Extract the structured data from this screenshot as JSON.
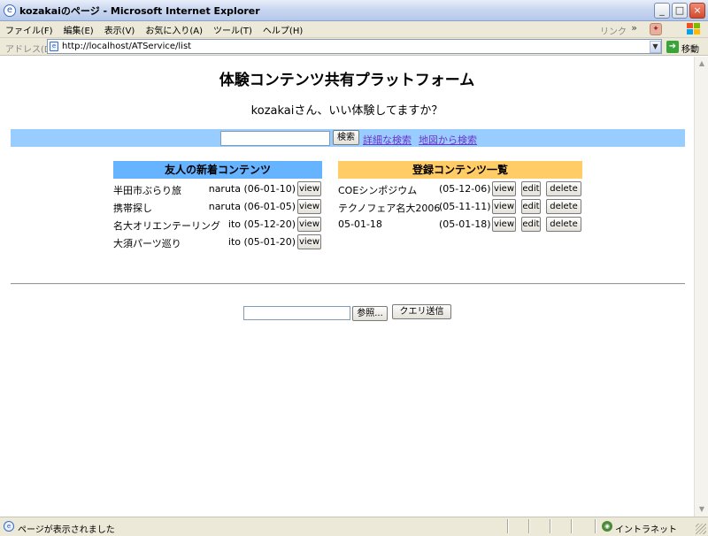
{
  "window": {
    "title": "kozakaiのページ - Microsoft Internet Explorer",
    "min": "_",
    "max": "□",
    "close": "×"
  },
  "menubar": {
    "items": [
      "ファイル(F)",
      "編集(E)",
      "表示(V)",
      "お気に入り(A)",
      "ツール(T)",
      "ヘルプ(H)"
    ],
    "links_label": "リンク",
    "chevron": "»"
  },
  "addressbar": {
    "label": "アドレス(D)",
    "url": "http://localhost/ATService/list",
    "go_label": "移動"
  },
  "page": {
    "title": "体験コンテンツ共有プラットフォーム",
    "greeting": "kozakaiさん、いい体験してますか？",
    "search_button": "検索",
    "search_value": "",
    "advanced_search": "詳細な検索",
    "map_search": "地図から検索",
    "friends_header": "友人の新着コンテンツ",
    "registered_header": "登録コンテンツ一覧",
    "view_label": "view",
    "edit_label": "edit",
    "delete_label": "delete",
    "friends_items": [
      {
        "title": "半田市ぶらり旅",
        "meta": "naruta (06-01-10)"
      },
      {
        "title": "携帯探し",
        "meta": "naruta (06-01-05)"
      },
      {
        "title": "名大オリエンテーリング",
        "meta": "ito (05-12-20)"
      },
      {
        "title": "大須パーツ巡り",
        "meta": "ito (05-01-20)"
      }
    ],
    "registered_items": [
      {
        "title": "COEシンポジウム",
        "date": "(05-12-06)"
      },
      {
        "title": "テクノフェア名大2006",
        "date": "(05-11-11)"
      },
      {
        "title": "05-01-18",
        "date": "(05-01-18)"
      }
    ],
    "browse_button": "参照...",
    "submit_button": "クエリ送信"
  },
  "statusbar": {
    "text": "ページが表示されました",
    "zone": "イントラネット"
  },
  "colors": {
    "search_bar": "#99ccff",
    "friends_header": "#66b3ff",
    "registered_header": "#ffcc66",
    "link": "#7034c8"
  }
}
